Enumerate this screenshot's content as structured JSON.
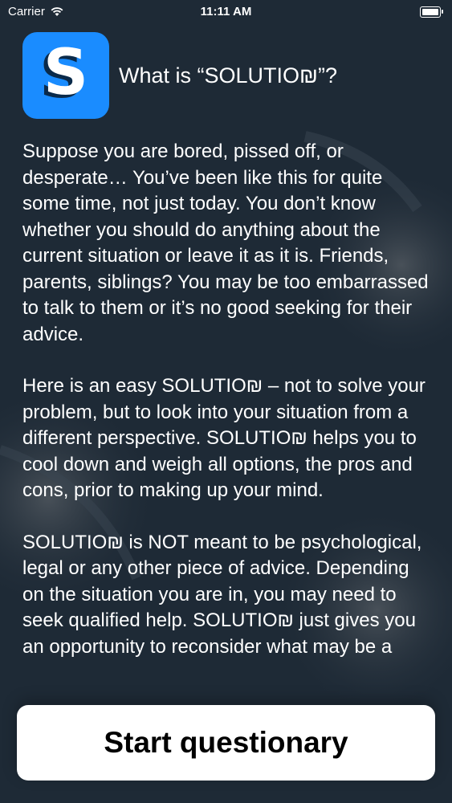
{
  "status_bar": {
    "carrier": "Carrier",
    "time": "11:11 AM"
  },
  "header": {
    "icon_letter": "S",
    "icon_color": "#1a8cff",
    "title": "What is “SOLUTIO₪”?"
  },
  "paragraphs": [
    "Suppose you are bored, pissed off, or desperate… You’ve been like this for quite some time, not just today. You don’t know whether you should do anything about the current situation or leave it as it is. Friends, parents, siblings? You may be too embarrassed to talk to them or it’s no good seeking for their advice.",
    "Here is an easy SOLUTIO₪ – not to solve your problem, but to look into your situation from a different perspective. SOLUTIO₪ helps you to cool down and weigh all options, the pros and cons, prior to making up your mind.",
    "SOLUTIO₪ is NOT meant to be psychological, legal or any other piece of advice. Depending on the situation you are in, you may need to seek qualified help. SOLUTIO₪ just gives you an opportunity to reconsider what may be a"
  ],
  "start_button": {
    "label": "Start questionary"
  }
}
